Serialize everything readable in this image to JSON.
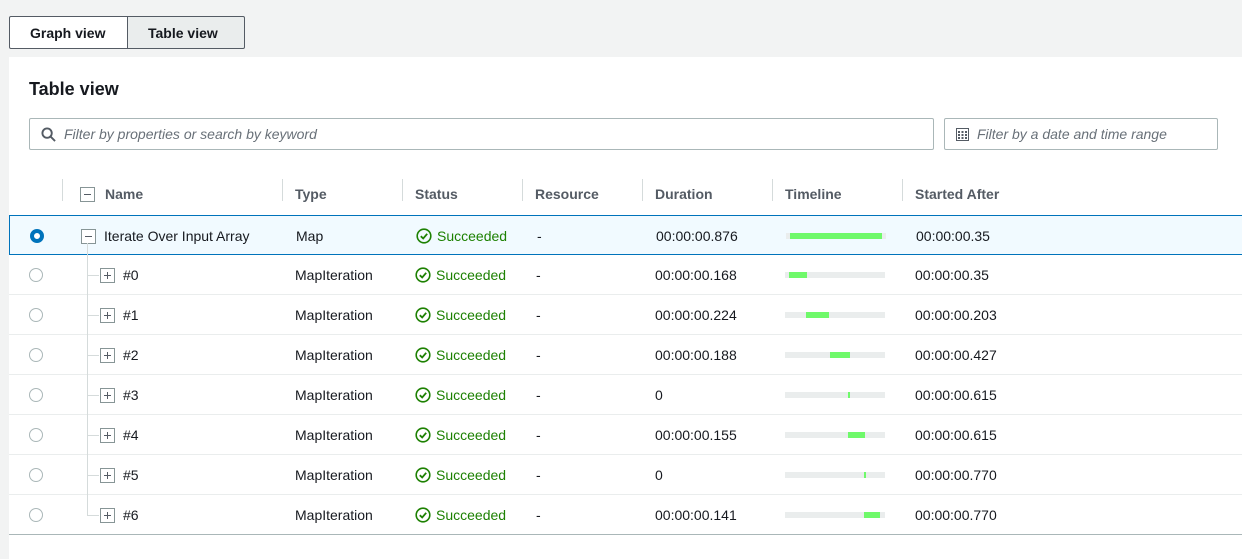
{
  "tabs": [
    {
      "label": "Graph view"
    },
    {
      "label": "Table view"
    }
  ],
  "panel": {
    "title": "Table view",
    "search_placeholder": "Filter by properties or search by keyword",
    "date_placeholder": "Filter by a date and time range"
  },
  "table": {
    "columns": [
      "Name",
      "Type",
      "Status",
      "Resource",
      "Duration",
      "Timeline",
      "Started After"
    ],
    "rows": [
      {
        "name": "Iterate Over Input Array",
        "type": "Map",
        "status": "Succeeded",
        "resource": "-",
        "duration": "00:00:00.876",
        "timeline_start": 0.04,
        "timeline_width": 0.92,
        "started_after": "00:00:00.35",
        "selected": true
      },
      {
        "name": "#0",
        "type": "MapIteration",
        "status": "Succeeded",
        "resource": "-",
        "duration": "00:00:00.168",
        "timeline_start": 0.04,
        "timeline_width": 0.18,
        "started_after": "00:00:00.35",
        "selected": false
      },
      {
        "name": "#1",
        "type": "MapIteration",
        "status": "Succeeded",
        "resource": "-",
        "duration": "00:00:00.224",
        "timeline_start": 0.21,
        "timeline_width": 0.23,
        "started_after": "00:00:00.203",
        "selected": false
      },
      {
        "name": "#2",
        "type": "MapIteration",
        "status": "Succeeded",
        "resource": "-",
        "duration": "00:00:00.188",
        "timeline_start": 0.45,
        "timeline_width": 0.2,
        "started_after": "00:00:00.427",
        "selected": false
      },
      {
        "name": "#3",
        "type": "MapIteration",
        "status": "Succeeded",
        "resource": "-",
        "duration": "0",
        "timeline_start": 0.63,
        "timeline_width": 0.02,
        "started_after": "00:00:00.615",
        "selected": false
      },
      {
        "name": "#4",
        "type": "MapIteration",
        "status": "Succeeded",
        "resource": "-",
        "duration": "00:00:00.155",
        "timeline_start": 0.63,
        "timeline_width": 0.17,
        "started_after": "00:00:00.615",
        "selected": false
      },
      {
        "name": "#5",
        "type": "MapIteration",
        "status": "Succeeded",
        "resource": "-",
        "duration": "0",
        "timeline_start": 0.79,
        "timeline_width": 0.02,
        "started_after": "00:00:00.770",
        "selected": false
      },
      {
        "name": "#6",
        "type": "MapIteration",
        "status": "Succeeded",
        "resource": "-",
        "duration": "00:00:00.141",
        "timeline_start": 0.79,
        "timeline_width": 0.16,
        "started_after": "00:00:00.770",
        "selected": false
      }
    ]
  },
  "colors": {
    "success": "#1d8102",
    "timeline_bar": "#6ff96a",
    "selected_border": "#0073bb"
  }
}
